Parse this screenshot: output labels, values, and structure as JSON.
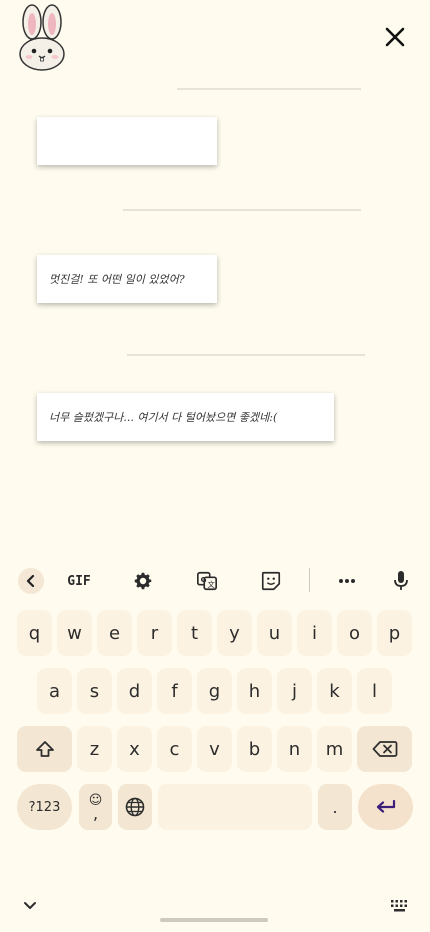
{
  "header": {
    "avatar_icon": "bunny-icon",
    "close_icon": "close-icon"
  },
  "messages": [
    {
      "text": ""
    },
    {
      "text": "멋진걸! 또 어떤 일이 있었어?"
    },
    {
      "text": "너무 슬펐겠구나... 여기서 다 털어놨으면 좋겠네:("
    }
  ],
  "keyboard": {
    "toolbar": {
      "back_icon": "chevron-left-icon",
      "gif_label": "GIF",
      "settings_icon": "gear-icon",
      "translate_icon": "translate-icon",
      "sticker_icon": "sticker-icon",
      "more_icon": "more-horizontal-icon",
      "mic_icon": "mic-icon"
    },
    "row1": [
      "q",
      "w",
      "e",
      "r",
      "t",
      "y",
      "u",
      "i",
      "o",
      "p"
    ],
    "row2": [
      "a",
      "s",
      "d",
      "f",
      "g",
      "h",
      "j",
      "k",
      "l"
    ],
    "row3": [
      "z",
      "x",
      "c",
      "v",
      "b",
      "n",
      "m"
    ],
    "symbols_label": "?123",
    "emoji_label": "☺",
    "comma_label": ",",
    "period_label": ".",
    "shift_icon": "shift-icon",
    "backspace_icon": "backspace-icon",
    "globe_icon": "globe-icon",
    "enter_icon": "enter-icon",
    "hide_icon": "chevron-down-icon",
    "keyboard_icon": "keyboard-grid-icon"
  },
  "colors": {
    "background": "#fffcef",
    "key": "#fbf2e1",
    "func_key": "#f3e6d2",
    "enter_arrow": "#3b1f7a"
  }
}
